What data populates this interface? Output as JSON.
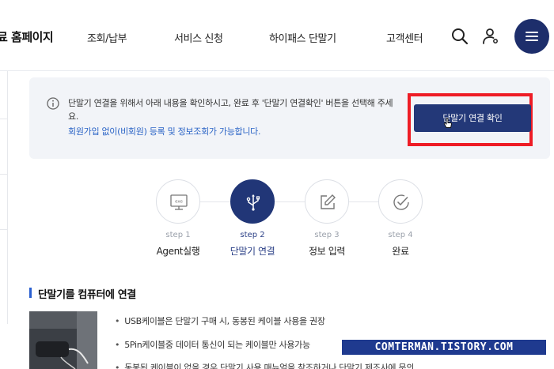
{
  "header": {
    "logo": "료 홈페이지",
    "nav": [
      "조회/납부",
      "서비스 신청",
      "하이패스 단말기",
      "고객센터"
    ],
    "icons": {
      "search": "search-icon",
      "user": "user-icon",
      "menu": "menu-icon"
    },
    "brand_color": "#1d2e6b"
  },
  "notice": {
    "icon": "info-icon",
    "text": "단말기 연결을 위해서 아래 내용을 확인하시고, 완료 후 '단말기 연결확인' 버튼을 선택해 주세요.",
    "sub": "회원가입 없이(비회원) 등록 및 정보조회가 가능합니다.",
    "button_label": "단말기 연결 확인",
    "highlight_color": "#ee1c25"
  },
  "steps": [
    {
      "num": "step 1",
      "label": "Agent실행",
      "icon": "monitor-exe-icon",
      "active": false
    },
    {
      "num": "step 2",
      "label": "단말기 연결",
      "icon": "usb-icon",
      "active": true
    },
    {
      "num": "step 3",
      "label": "정보 입력",
      "icon": "edit-icon",
      "active": false
    },
    {
      "num": "step 4",
      "label": "완료",
      "icon": "check-circle-icon",
      "active": false
    }
  ],
  "section": {
    "title": "단말기를 컴퓨터에 연결",
    "bullets": [
      "USB케이블은 단말기 구매 시, 동봉된 케이블 사용을 권장",
      "5Pin케이블중 데이터 통신이 되는 케이블만 사용가능",
      "동봉된 케이블이 없을 경우 단말기 사용 매뉴얼을 참조하거나 단말기 제조사에 문의"
    ]
  },
  "watermark": "COMTERMAN.TISTORY.COM"
}
